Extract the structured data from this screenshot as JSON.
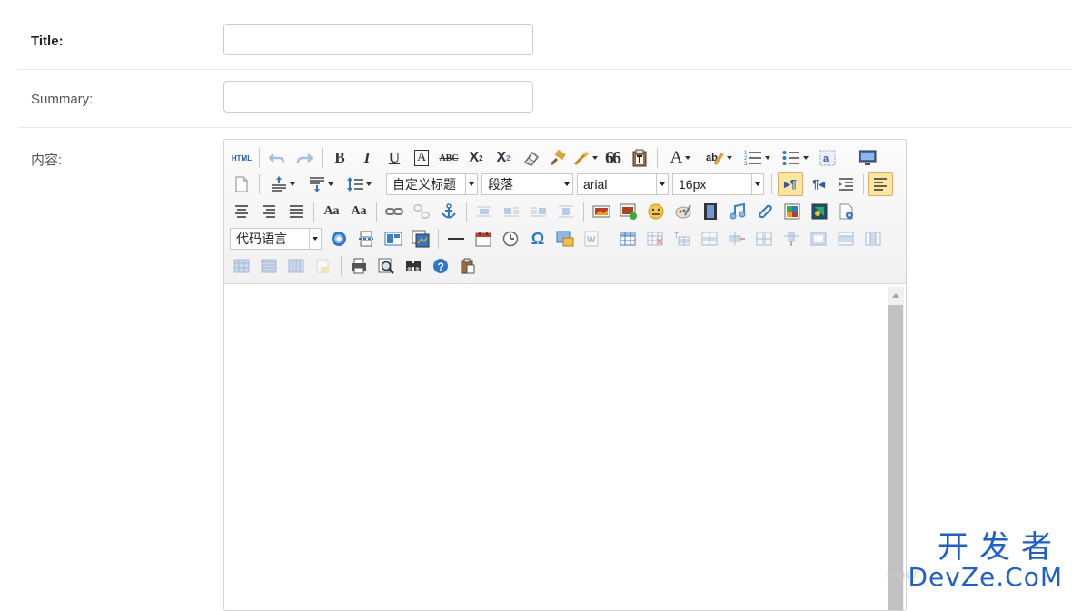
{
  "form": {
    "title_label": "Title:",
    "summary_label": "Summary:",
    "content_label": "内容:"
  },
  "editor": {
    "toolbar_row1": [
      "html-source-icon",
      "undo-icon",
      "redo-icon",
      "bold-icon",
      "italic-icon",
      "underline-icon",
      "frame-text-icon",
      "strikethrough-icon",
      "superscript-icon",
      "subscript-icon",
      "eraser-icon",
      "format-brush-icon",
      "auto-format-icon",
      "blockquote-icon",
      "paste-plain-icon",
      "font-color-icon",
      "highlight-color-icon",
      "ordered-list-icon",
      "unordered-list-icon",
      "select-all-icon",
      "preview-icon"
    ],
    "html_label": "HTML",
    "quote_glyph": "66",
    "custom_heading": "自定义标题",
    "paragraph": "段落",
    "font_family": "arial",
    "font_size": "16px",
    "code_language": "代码语言",
    "text_bold": "B",
    "text_italic": "I",
    "text_underline": "U",
    "text_frame": "A",
    "text_strike": "ABC",
    "text_sup": "X",
    "text_sub": "X",
    "text_font_color": "A",
    "text_omega": "Ω",
    "text_ltr": "▸¶",
    "text_rtl": "¶◂",
    "text_case_upper": "Aa",
    "text_case_lower": "Aa"
  },
  "watermark": {
    "cn": "开发者",
    "en": "DevZe.CoM",
    "url": "https://"
  },
  "colors": {
    "active_bg": "#ffe69f",
    "watermark": "#1e5fd0",
    "icon_blue": "#2e77c9"
  }
}
